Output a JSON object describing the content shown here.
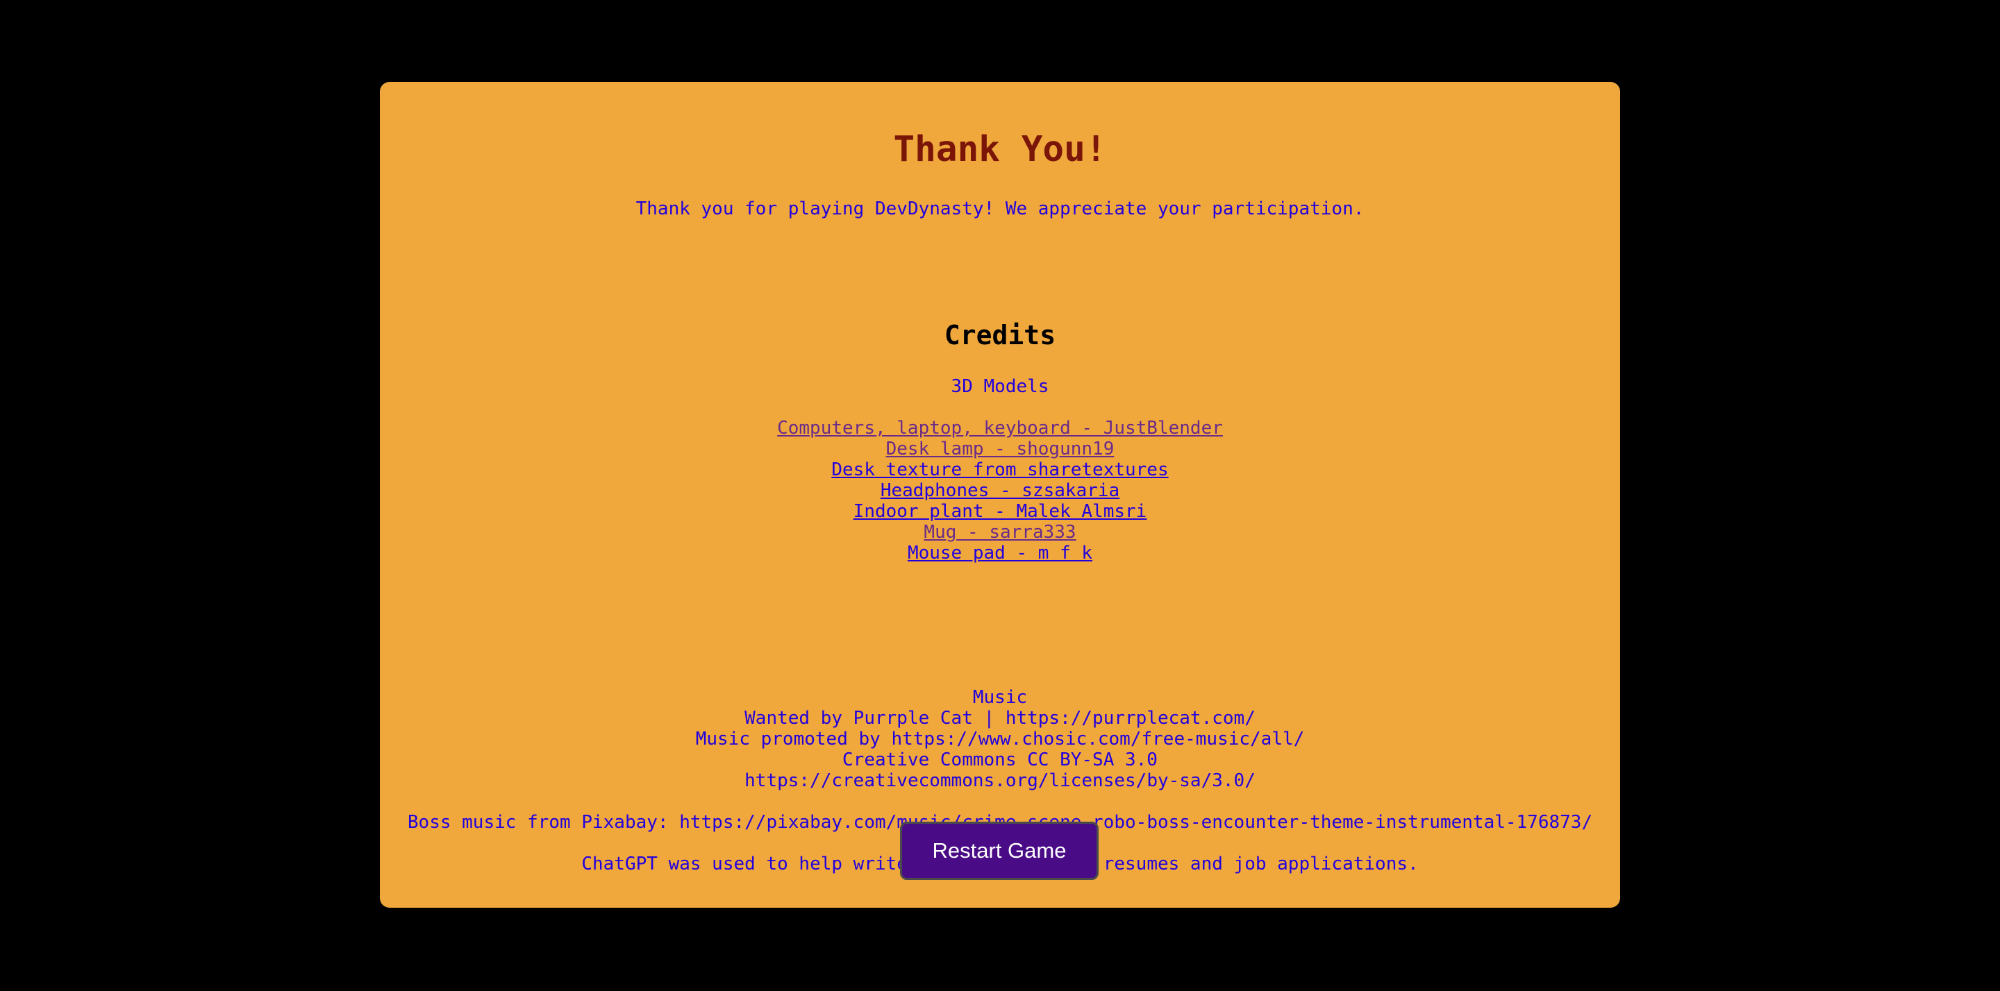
{
  "page": {
    "title": "Thank You!",
    "lead": "Thank you for playing DevDynasty! We appreciate your participation."
  },
  "credits": {
    "heading": "Credits",
    "models_label": "3D Models",
    "models": [
      {
        "text": "Computers, laptop, keyboard - JustBlender",
        "visited": true
      },
      {
        "text": "Desk lamp - shogunn19",
        "visited": true
      },
      {
        "text": "Desk texture from sharetextures",
        "visited": false
      },
      {
        "text": "Headphones - szsakaria",
        "visited": false
      },
      {
        "text": "Indoor plant - Malek Almsri",
        "visited": false
      },
      {
        "text": "Mug - sarra333",
        "visited": true
      },
      {
        "text": "Mouse pad - m f k",
        "visited": false
      }
    ],
    "music_lines": [
      "Music",
      "Wanted by Purrple Cat | https://purrplecat.com/",
      "Music promoted by https://www.chosic.com/free-music/all/",
      "Creative Commons CC BY-SA 3.0",
      "https://creativecommons.org/licenses/by-sa/3.0/"
    ],
    "boss_music": "Boss music from Pixabay: https://pixabay.com/music/crime-scene-robo-boss-encounter-theme-instrumental-176873/",
    "chatgpt_note": "ChatGPT was used to help write English text for resumes and job applications."
  },
  "actions": {
    "restart_label": "Restart Game"
  },
  "colors": {
    "background": "#000000",
    "card": "#f0a83d",
    "title": "#7a1508",
    "text": "#2200dd",
    "visited_link": "#6a2a8a",
    "button": "#4a0c86"
  }
}
